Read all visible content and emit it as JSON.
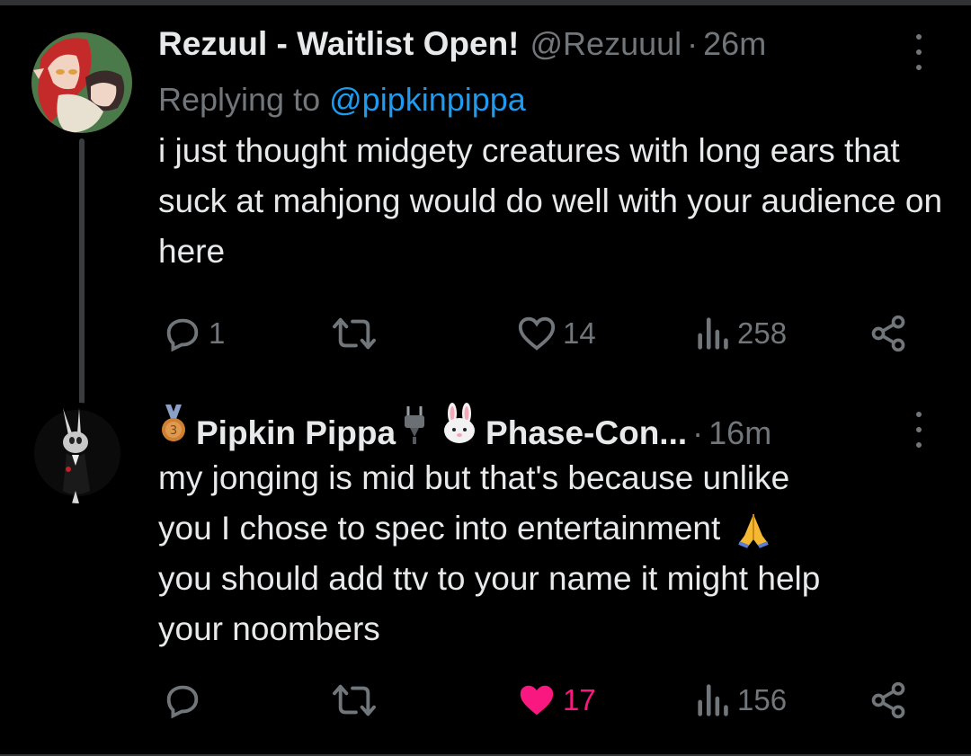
{
  "tweets": [
    {
      "author": {
        "name": "Rezuul - Waitlist Open!",
        "handle": "@Rezuuul",
        "avatar": "anime-characters-avatar"
      },
      "separator": "·",
      "time": "26m",
      "replying_prefix": "Replying to",
      "replying_to": "@pipkinpippa",
      "text": "i just thought midgety creatures with long ears that suck at mahjong would do well with your audience on here",
      "actions": {
        "reply_count": "1",
        "retweet_count": "",
        "like_count": "14",
        "views_count": "258",
        "liked": false
      }
    },
    {
      "author": {
        "name_prefix_icon": "bronze-medal-icon",
        "name": "Pipkin Pippa",
        "name_mid_icon1": "plug-icon",
        "name_mid_icon2": "rabbit-face-icon",
        "name_suffix": "Phase-Con...",
        "avatar": "rabbit-in-tuxedo-avatar"
      },
      "separator": "·",
      "time": "16m",
      "text_lines": [
        "my jonging is mid but that's because unlike",
        "you I chose to spec into entertainment",
        "you should add ttv to your name it might help",
        "your noombers"
      ],
      "text_emoji": "folded-hands-icon",
      "actions": {
        "reply_count": "",
        "retweet_count": "",
        "like_count": "17",
        "views_count": "156",
        "liked": true
      }
    }
  ],
  "colors": {
    "background": "#000000",
    "text_primary": "#e7e9ea",
    "text_secondary": "#71767b",
    "link": "#1d9bf0",
    "like_active": "#f91880",
    "thread_line": "#3a3d40"
  }
}
